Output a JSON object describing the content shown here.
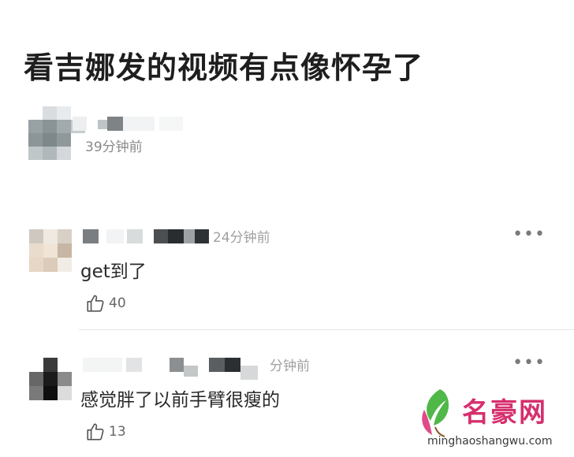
{
  "post": {
    "title": "看吉娜发的视频有点像怀孕了",
    "time": "39分钟前"
  },
  "comments": [
    {
      "time": "24分钟前",
      "text": "get到了",
      "likes": "40"
    },
    {
      "time": "分钟前",
      "text": "感觉胖了以前手臂很瘦的",
      "likes": "13"
    }
  ],
  "icons": {
    "more": "more-horizontal-icon",
    "like": "thumbs-up-icon"
  },
  "watermark": {
    "brand": "名豪网",
    "url": "minghaoshangwu.com"
  },
  "colors": {
    "watermark_brand": "#d62f6e"
  }
}
